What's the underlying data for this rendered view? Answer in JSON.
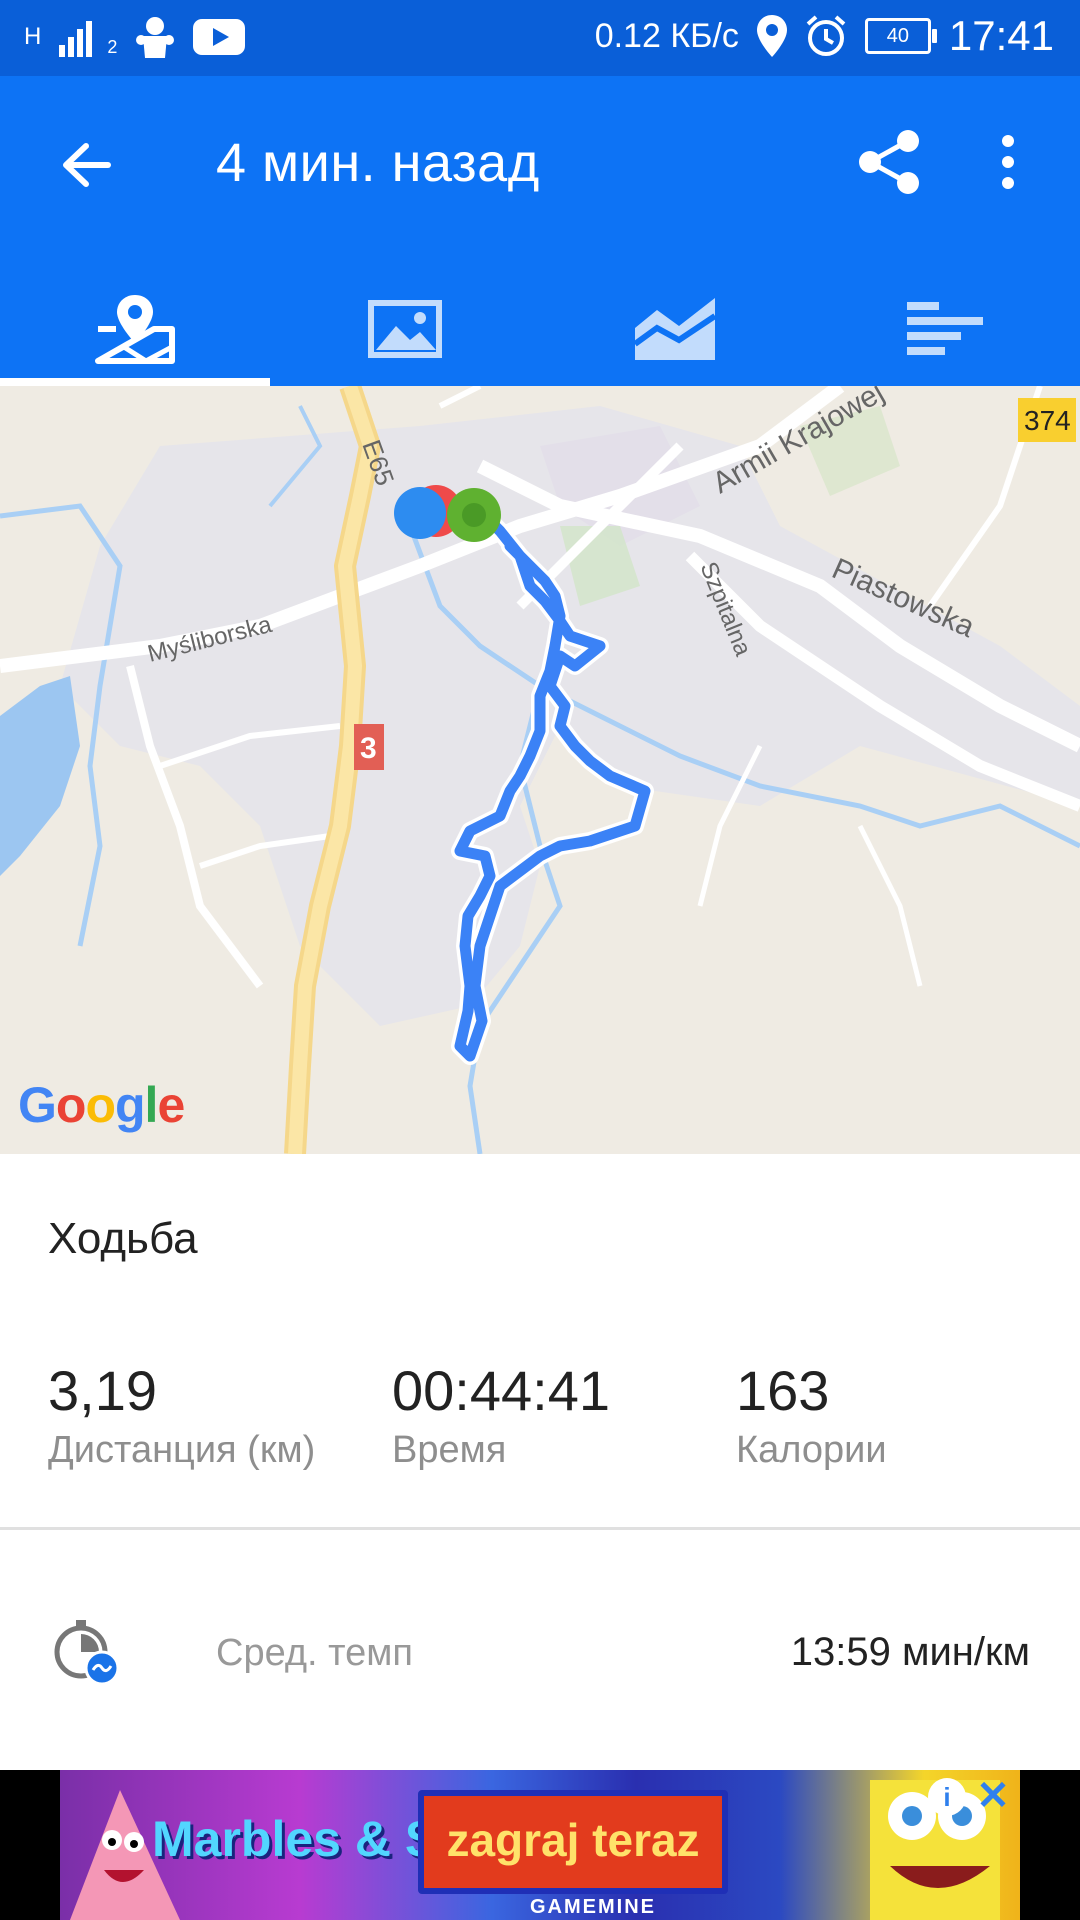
{
  "status_bar": {
    "network_type": "H",
    "sim_index": "2",
    "speed": "0.12 КБ/с",
    "battery": "40",
    "time": "17:41"
  },
  "app_bar": {
    "title": "4 мин. назад",
    "icons": {
      "back": "arrow-back-icon",
      "share": "share-icon",
      "more": "more-vert-icon"
    }
  },
  "tabs": [
    {
      "icon": "map-pin-icon",
      "active": true
    },
    {
      "icon": "photo-icon",
      "active": false
    },
    {
      "icon": "chart-area-icon",
      "active": false
    },
    {
      "icon": "bars-icon",
      "active": false
    }
  ],
  "map": {
    "labels": {
      "road_e65": "E65",
      "road_3": "3",
      "road_374": "374",
      "armii": "Armii Krajowej",
      "mysliborska": "Myśliborska",
      "szpitalna": "Szpitalna",
      "piastowska": "Piastowska"
    },
    "google": [
      "G",
      "o",
      "o",
      "g",
      "l",
      "e"
    ],
    "colors": {
      "route": "#3b82f6",
      "start_marker": "#2d8cf0",
      "end_marker": "#5fb130",
      "mid_marker": "#ef4a4a"
    }
  },
  "activity": {
    "type": "Ходьба"
  },
  "stats": [
    {
      "value": "3,19",
      "label": "Дистанция (км)"
    },
    {
      "value": "00:44:41",
      "label": "Время"
    },
    {
      "value": "163",
      "label": "Калории"
    }
  ],
  "pace": {
    "icon": "timer-icon",
    "label": "Сред. темп",
    "value": "13:59 мин/км"
  },
  "ad": {
    "game_title": "Marbles & Slides",
    "cta": "zagraj teraz",
    "brand": "GAMEMINE",
    "info": "i",
    "close": "✕"
  },
  "colors": {
    "app_bar": "#0d73f5",
    "status_bar": "#0a5fd8"
  }
}
